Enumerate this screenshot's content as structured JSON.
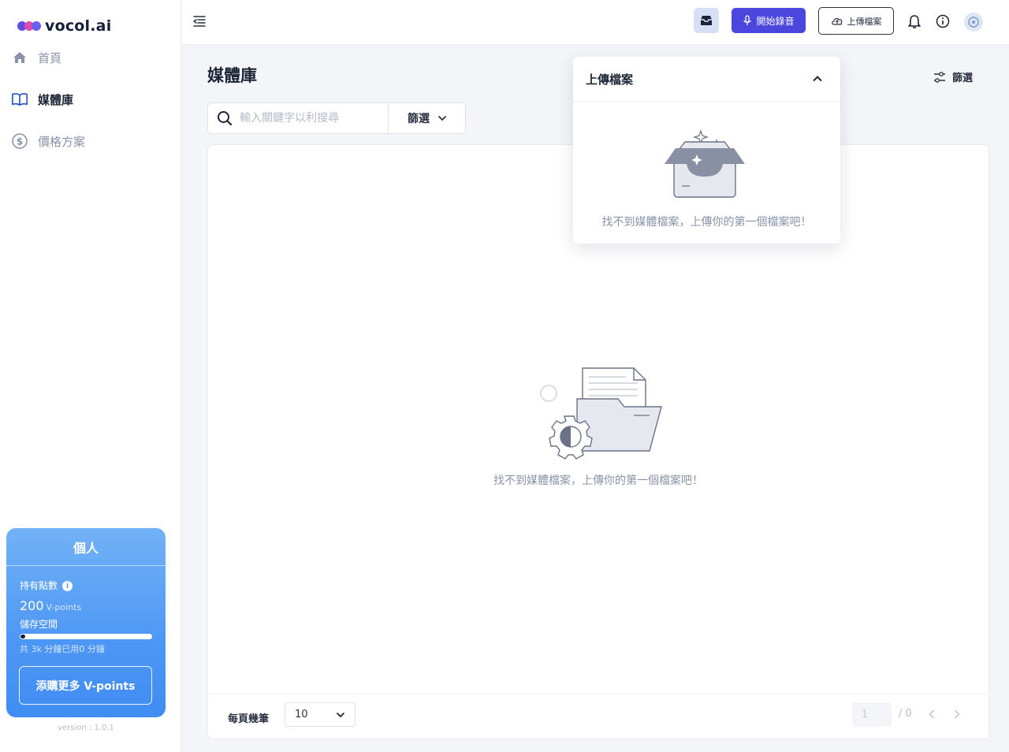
{
  "brand": {
    "name": "vocol.ai",
    "colors": {
      "primary": "#4b46dd",
      "accent_blue": "#4d97f5",
      "dot1": "#5b4ee8",
      "dot2": "#e04aa8",
      "dot3": "#6a5ff0"
    }
  },
  "sidebar": {
    "items": [
      {
        "label": "首頁",
        "icon": "home-icon",
        "active": false
      },
      {
        "label": "媒體庫",
        "icon": "book-icon",
        "active": true
      },
      {
        "label": "價格方案",
        "icon": "dollar-icon",
        "active": false
      }
    ],
    "plan_card": {
      "title": "個人",
      "points_label": "持有點數",
      "points_value": "200",
      "points_unit": "V-points",
      "storage_label": "儲存空間",
      "storage_used_fraction": 0.02,
      "storage_text": "共 3k 分鐘已用0 分鐘",
      "buy_button": "添購更多 V-points"
    },
    "version": "version : 1.0.1"
  },
  "header": {
    "record_button": "開始錄音",
    "upload_button": "上傳檔案"
  },
  "page": {
    "title": "媒體庫",
    "filter_label": "篩選",
    "search": {
      "placeholder": "輸入關鍵字以利搜尋",
      "filter_label": "篩選"
    },
    "empty_text": "找不到媒體檔案，上傳你的第一個檔案吧！",
    "pagination": {
      "per_page_label": "每頁幾筆",
      "per_page_value": "10",
      "current_page": "1",
      "total_pages": "/ 0"
    }
  },
  "upload_popover": {
    "title": "上傳檔案",
    "empty_text": "找不到媒體檔案，上傳你的第一個檔案吧！"
  }
}
